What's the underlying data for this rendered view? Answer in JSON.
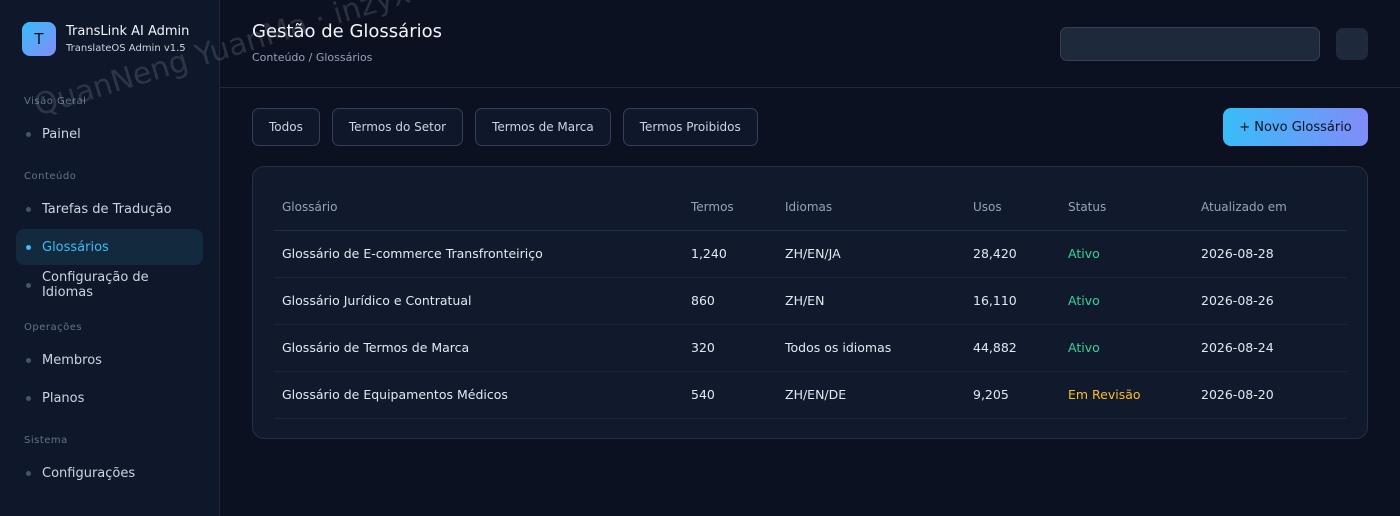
{
  "brand": {
    "logo_letter": "T",
    "title": "TransLink AI Admin",
    "subtitle": "TranslateOS Admin v1.5"
  },
  "sidebar": {
    "sections": [
      {
        "label": "Visão Geral"
      },
      {
        "label": "Conteúdo"
      },
      {
        "label": "Operações"
      },
      {
        "label": "Sistema"
      }
    ],
    "items": [
      {
        "label": "Painel",
        "active": false
      },
      {
        "label": "Tarefas de Tradução",
        "active": false
      },
      {
        "label": "Glossários",
        "active": true
      },
      {
        "label": "Configuração de Idiomas",
        "active": false
      },
      {
        "label": "Membros",
        "active": false
      },
      {
        "label": "Planos",
        "active": false
      },
      {
        "label": "Configurações",
        "active": false
      }
    ]
  },
  "header": {
    "title": "Gestão de Glossários",
    "breadcrumb": "Conteúdo / Glossários",
    "search_value": ""
  },
  "filters": [
    "Todos",
    "Termos do Setor",
    "Termos de Marca",
    "Termos Proibidos"
  ],
  "new_button_label": "+ Novo Glossário",
  "table": {
    "columns": [
      "Glossário",
      "Termos",
      "Idiomas",
      "Usos",
      "Status",
      "Atualizado em"
    ],
    "rows": [
      [
        "Glossário de E-commerce Transfronteiriço",
        "1,240",
        "ZH/EN/JA",
        "28,420",
        "Ativo",
        "2026-08-28"
      ],
      [
        "Glossário Jurídico e Contratual",
        "860",
        "ZH/EN",
        "16,110",
        "Ativo",
        "2026-08-26"
      ],
      [
        "Glossário de Termos de Marca",
        "320",
        "Todos os idiomas",
        "44,882",
        "Ativo",
        "2026-08-24"
      ],
      [
        "Glossário de Equipamentos Médicos",
        "540",
        "ZH/EN/DE",
        "9,205",
        "Em Revisão",
        "2026-08-20"
      ]
    ]
  },
  "watermark": "QuanNeng YuanMa · inzyxuashop.com",
  "colors": {
    "accent": "#38bdf8",
    "accent_secondary": "#818cf8",
    "status_active": "#34d399",
    "status_review": "#fbbf24",
    "background": "#0b1120",
    "sidebar": "#0f172a"
  }
}
